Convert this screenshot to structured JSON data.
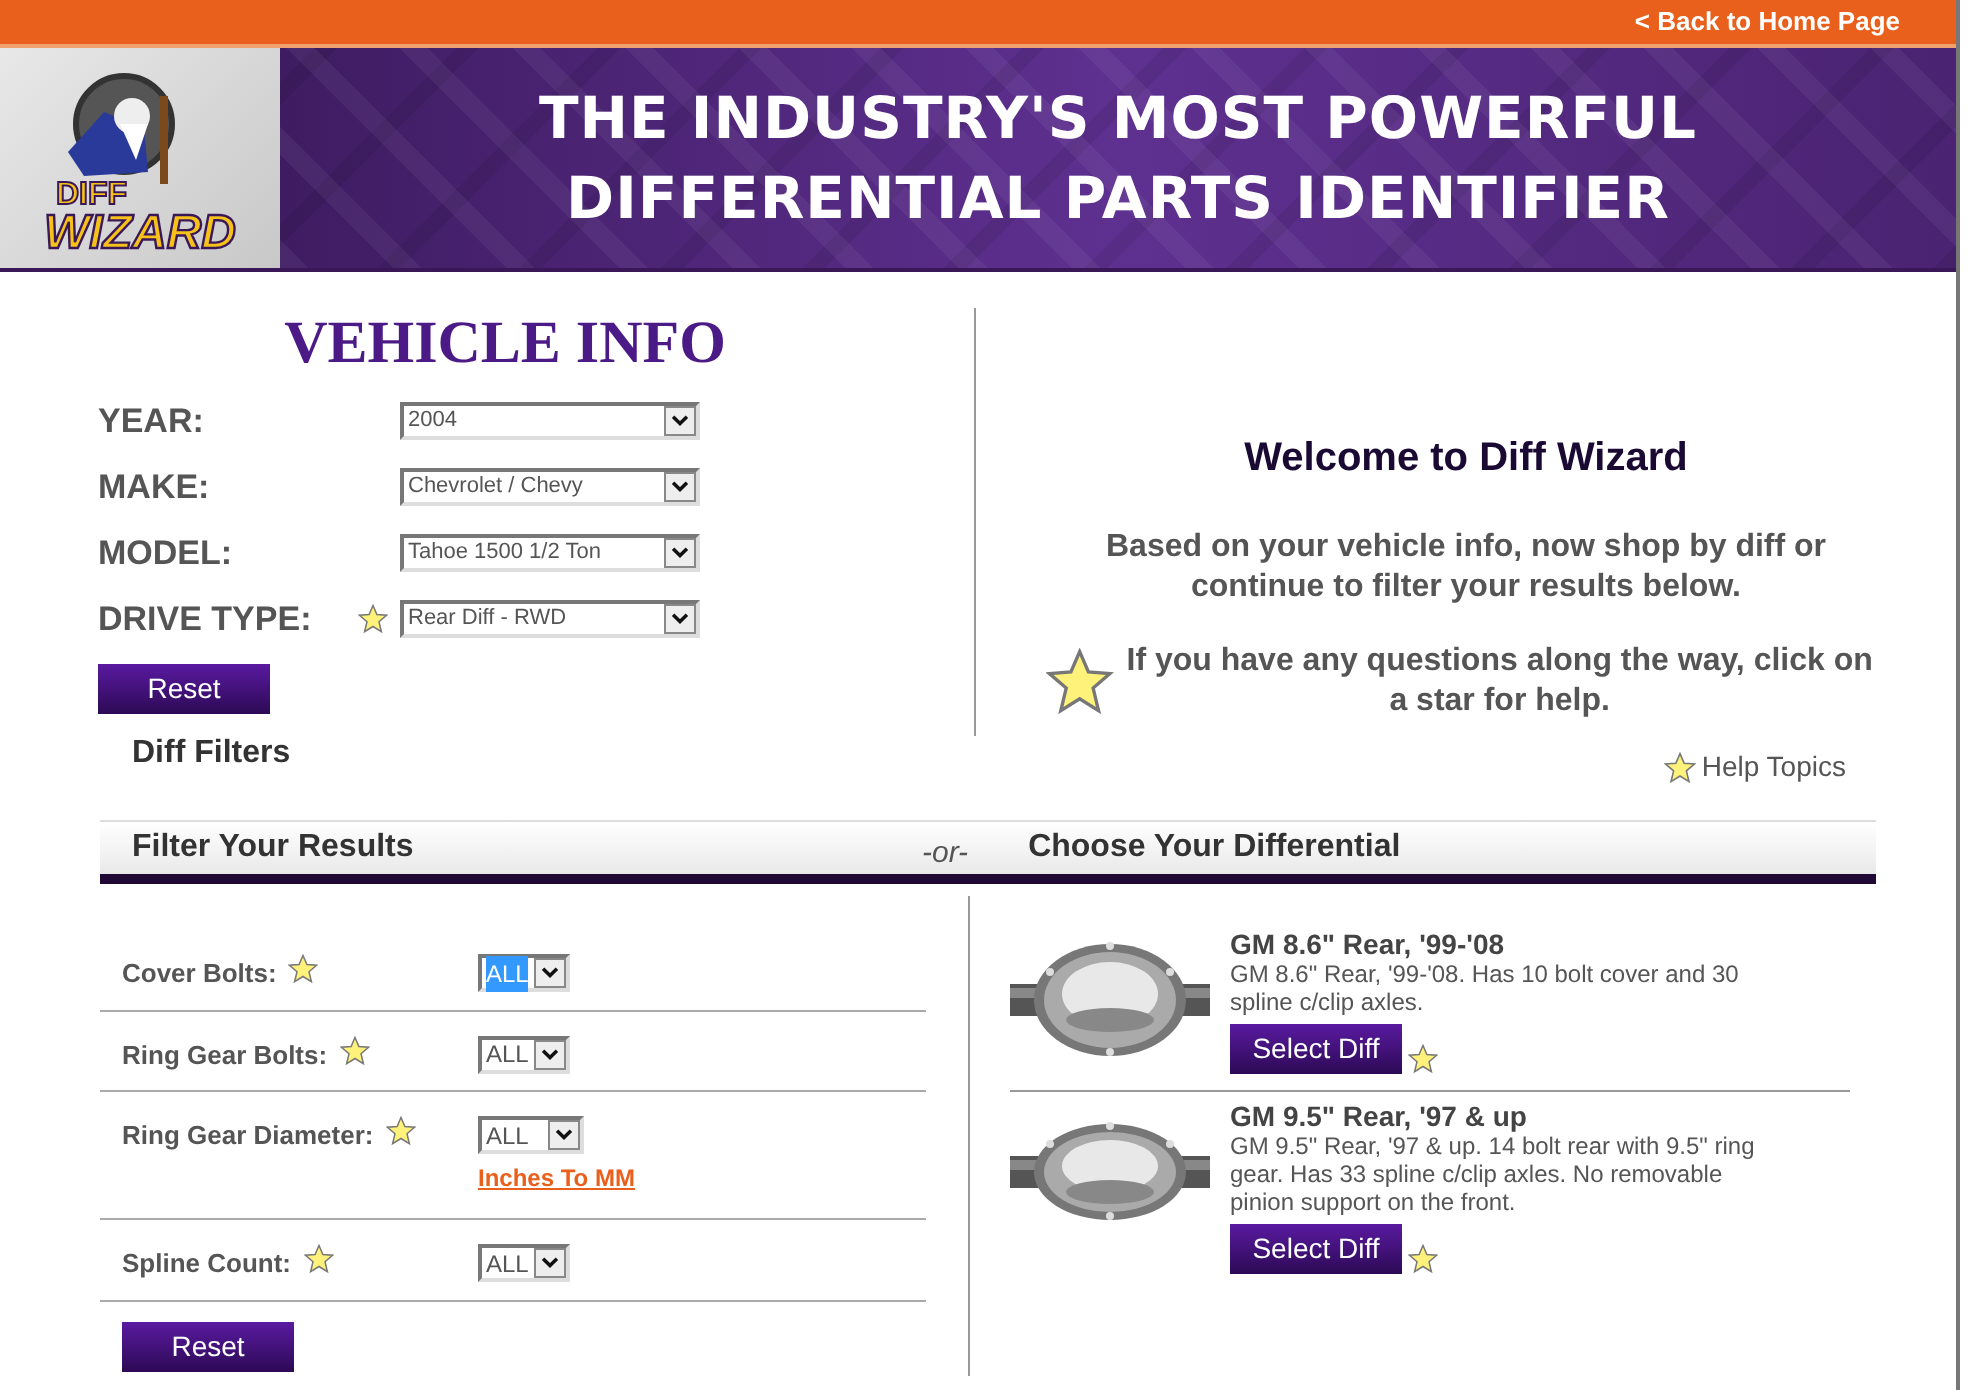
{
  "top_bar": {
    "link": "< Back to Home Page"
  },
  "banner": {
    "logo": {
      "line_1": "DIFF",
      "line_2": "WIZARD"
    },
    "headline": [
      "THE INDUSTRY'S MOST POWERFUL",
      "DIFFERENTIAL PARTS IDENTIFIER"
    ]
  },
  "vehicle_info": {
    "title": "VEHICLE INFO",
    "fields": [
      {
        "label": "YEAR:",
        "value": "2004",
        "help": false
      },
      {
        "label": "MAKE:",
        "value": "Chevrolet / Chevy",
        "help": false
      },
      {
        "label": "MODEL:",
        "value": "Tahoe 1500 1/2 Ton",
        "help": false
      },
      {
        "label": "DRIVE TYPE:",
        "value": "Rear Diff - RWD",
        "help": true
      }
    ],
    "reset": "Reset"
  },
  "welcome": {
    "title": "Welcome to Diff Wizard",
    "text": "Based on your vehicle info, now shop by diff or continue to filter your results below.",
    "help_text": "If you have any questions along the way, click on a star for help.",
    "help_topics": "Help Topics"
  },
  "diff_filters_label": "Diff Filters",
  "filter_bar": {
    "left": "Filter Your Results",
    "separator": "-or-",
    "right": "Choose Your Differential"
  },
  "filters": [
    {
      "label": "Cover Bolts:",
      "value": "ALL",
      "focused": true
    },
    {
      "label": "Ring Gear Bolts:",
      "value": "ALL",
      "focused": false
    },
    {
      "label": "Ring Gear Diameter:",
      "value": "ALL",
      "focused": false,
      "link": "Inches To MM"
    },
    {
      "label": "Spline Count:",
      "value": "ALL",
      "focused": false
    }
  ],
  "filter_reset": "Reset",
  "differentials": [
    {
      "title": "GM 8.6\" Rear, '99-'08",
      "description": "GM 8.6\" Rear, '99-'08. Has 10 bolt cover and 30 spline c/clip axles.",
      "button": "Select Diff"
    },
    {
      "title": "GM 9.5\" Rear, '97 & up",
      "description": "GM 9.5\" Rear, '97 & up. 14 bolt rear with 9.5\" ring gear. Has 33 spline c/clip axles. No removable pinion support on the front.",
      "button": "Select Diff"
    }
  ]
}
